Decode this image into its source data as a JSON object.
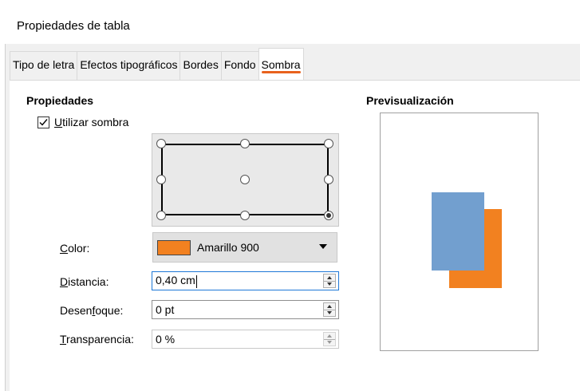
{
  "window": {
    "title": "Propiedades de tabla"
  },
  "tabs": [
    {
      "label": "Tipo de letra",
      "active": false
    },
    {
      "label": "Efectos tipográficos",
      "active": false
    },
    {
      "label": "Bordes",
      "active": false
    },
    {
      "label": "Fondo",
      "active": false
    },
    {
      "label": "Sombra",
      "active": true
    }
  ],
  "properties": {
    "heading": "Propiedades",
    "use_shadow": {
      "label_first": "U",
      "label_rest": "tilizar sombra",
      "checked": true
    },
    "position": {
      "selected": "bottom-right"
    },
    "color": {
      "label_first": "C",
      "label_rest": "olor:",
      "value": "Amarillo 900",
      "swatch_hex": "#f28120"
    },
    "distance": {
      "label_first": "D",
      "label_rest": "istancia:",
      "value": "0,40 cm"
    },
    "blur": {
      "label_pre": "Desen",
      "label_u": "f",
      "label_post": "oque:",
      "value": "0 pt"
    },
    "transparency": {
      "label_first": "T",
      "label_rest": "ransparencia:",
      "value": "0 %"
    }
  },
  "preview": {
    "heading": "Previsualización",
    "shape_hex": "#729fcf",
    "shadow_hex": "#f28120"
  },
  "colors": {
    "accent": "#e8621d",
    "focus": "#1e78d7"
  }
}
